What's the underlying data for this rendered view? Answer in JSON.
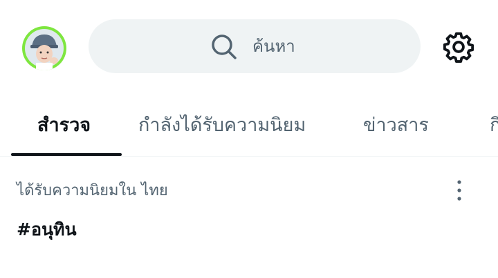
{
  "header": {
    "search": {
      "placeholder": "ค้นหา"
    }
  },
  "tabs": [
    {
      "label": "สำรวจ",
      "active": true
    },
    {
      "label": "กำลังได้รับความนิยม",
      "active": false
    },
    {
      "label": "ข่าวสาร",
      "active": false
    },
    {
      "label": "กี",
      "active": false
    }
  ],
  "trend": {
    "context": "ได้รับความนิยมใน ไทย",
    "title": "#อนุทิน"
  },
  "colors": {
    "text_primary": "#0f1419",
    "text_secondary": "#536471",
    "search_bg": "#eff3f4",
    "avatar_ring": "#7ee63f"
  }
}
